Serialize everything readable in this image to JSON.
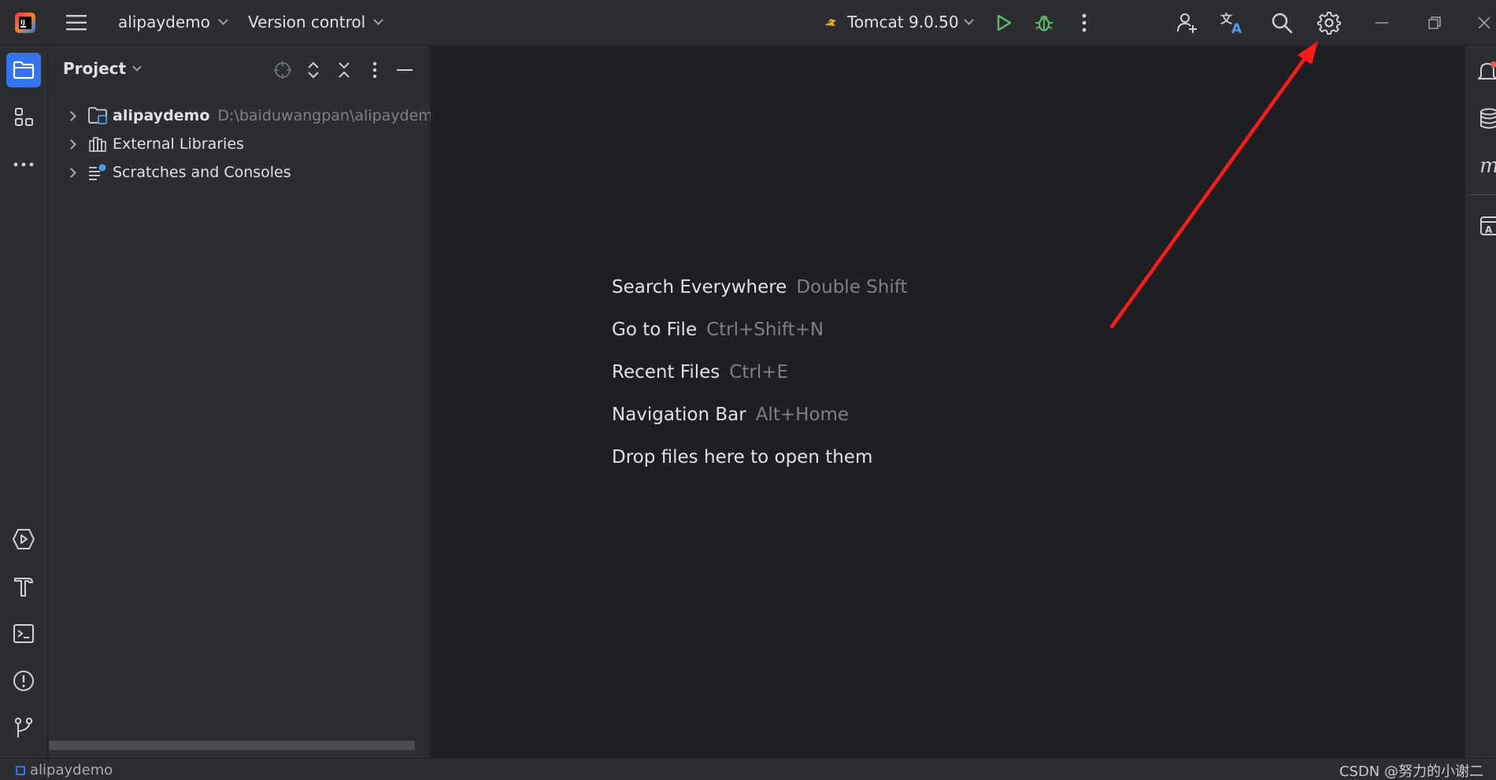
{
  "titlebar": {
    "project_name": "alipaydemo",
    "vcs_label": "Version control",
    "run_config": "Tomcat 9.0.50"
  },
  "project_panel": {
    "title": "Project",
    "tree": [
      {
        "label": "alipaydemo",
        "path": "D:\\baiduwangpan\\alipaydemo",
        "icon": "module-folder-icon"
      },
      {
        "label": "External Libraries",
        "icon": "libraries-icon"
      },
      {
        "label": "Scratches and Consoles",
        "icon": "scratches-icon"
      }
    ]
  },
  "editor": {
    "hints": [
      {
        "label": "Search Everywhere",
        "key": "Double Shift"
      },
      {
        "label": "Go to File",
        "key": "Ctrl+Shift+N"
      },
      {
        "label": "Recent Files",
        "key": "Ctrl+E"
      },
      {
        "label": "Navigation Bar",
        "key": "Alt+Home"
      },
      {
        "label": "Drop files here to open them",
        "key": ""
      }
    ]
  },
  "statusbar": {
    "project": "alipaydemo",
    "watermark": "CSDN @努力的小谢二"
  },
  "colors": {
    "background": "#2b2d30",
    "editor_background": "#1e1f22",
    "accent": "#3574f0",
    "run_green": "#5fb865",
    "annotation_red": "#ff1a1a"
  }
}
